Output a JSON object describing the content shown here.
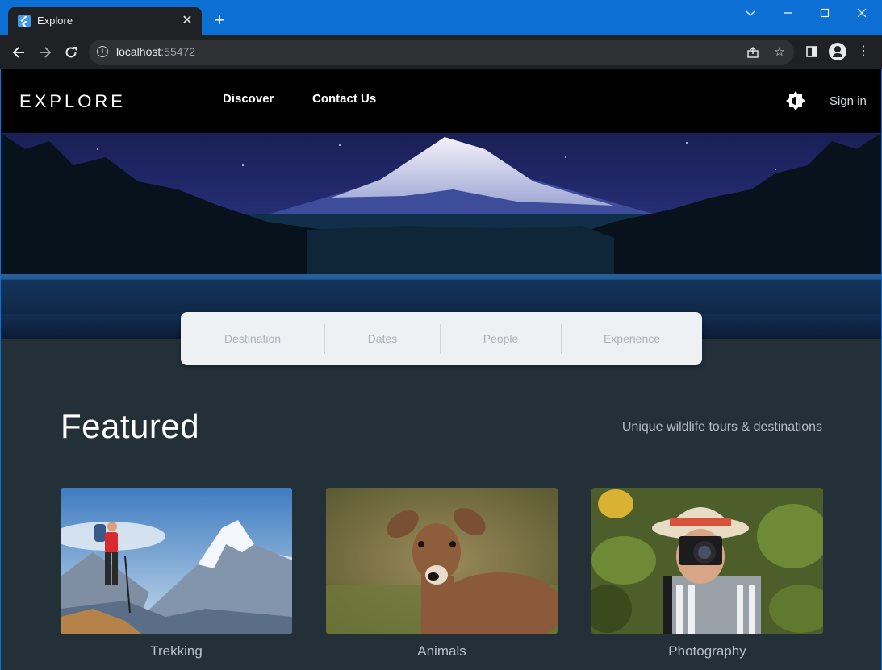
{
  "browser": {
    "tab_title": "Explore",
    "tab_close": "✕",
    "new_tab": "+",
    "url_host": "localhost",
    "url_port": ":55472"
  },
  "site": {
    "logo": "EXPLORE",
    "nav": [
      "Discover",
      "Contact Us"
    ],
    "sign_in": "Sign in"
  },
  "search": {
    "fields": [
      "Destination",
      "Dates",
      "People",
      "Experience"
    ]
  },
  "featured": {
    "title": "Featured",
    "subtitle": "Unique wildlife tours & destinations",
    "cards": [
      "Trekking",
      "Animals",
      "Photography"
    ]
  },
  "colors": {
    "titlebar": "#0b6fd3",
    "page_background": "#243038",
    "header_background": "#000000",
    "search_background": "#eef1f4"
  },
  "icons": [
    "flutter-favicon",
    "close-icon",
    "plus-icon",
    "chevron-down-icon",
    "minimize-icon",
    "maximize-icon",
    "close-window-icon",
    "back-arrow-icon",
    "forward-arrow-icon",
    "reload-icon",
    "info-icon",
    "share-icon",
    "star-icon",
    "sidebar-icon",
    "profile-icon",
    "more-vert-icon",
    "brightness-icon"
  ]
}
